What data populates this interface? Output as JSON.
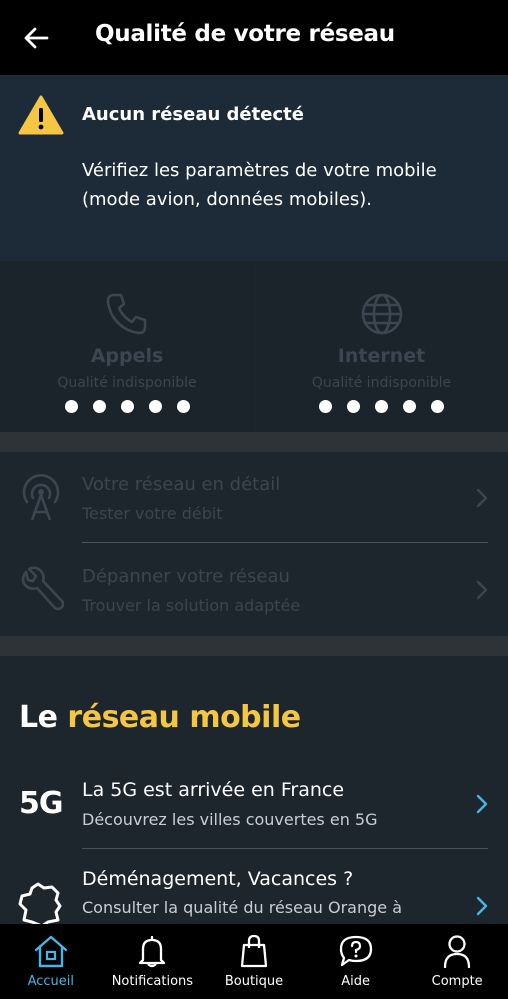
{
  "header": {
    "title": "Qualité de votre réseau"
  },
  "alert": {
    "title": "Aucun réseau détecté",
    "text": "Vérifiez les paramètres de votre mobile (mode avion, données mobiles)."
  },
  "quality": {
    "calls": {
      "title": "Appels",
      "subtitle": "Qualité indisponible",
      "icon": "phone-icon"
    },
    "internet": {
      "title": "Internet",
      "subtitle": "Qualité indisponible",
      "icon": "globe-icon"
    }
  },
  "menu": {
    "items": [
      {
        "title": "Votre réseau en détail",
        "subtitle": "Tester votre débit",
        "icon": "antenna-icon"
      },
      {
        "title": "Dépanner votre réseau",
        "subtitle": "Trouver la solution adaptée",
        "icon": "wrench-icon"
      }
    ]
  },
  "section": {
    "title_prefix": "Le ",
    "title_accent": "réseau mobile",
    "items": [
      {
        "badge": "5G",
        "title": "La 5G est arrivée en France",
        "subtitle": "Découvrez les villes couvertes en 5G"
      },
      {
        "title": "Déménagement, Vacances ?",
        "subtitle": "Consulter la qualité du réseau Orange à",
        "icon": "france-map-icon"
      }
    ]
  },
  "tabs": [
    {
      "label": "Accueil",
      "icon": "home-icon",
      "active": true
    },
    {
      "label": "Notifications",
      "icon": "bell-icon"
    },
    {
      "label": "Boutique",
      "icon": "shopping-bag-icon"
    },
    {
      "label": "Aide",
      "icon": "help-bubble-icon"
    },
    {
      "label": "Compte",
      "icon": "user-icon"
    }
  ],
  "colors": {
    "accent": "#f5c544",
    "active_tab": "#4bb4e6",
    "warning": "#f5c544"
  }
}
